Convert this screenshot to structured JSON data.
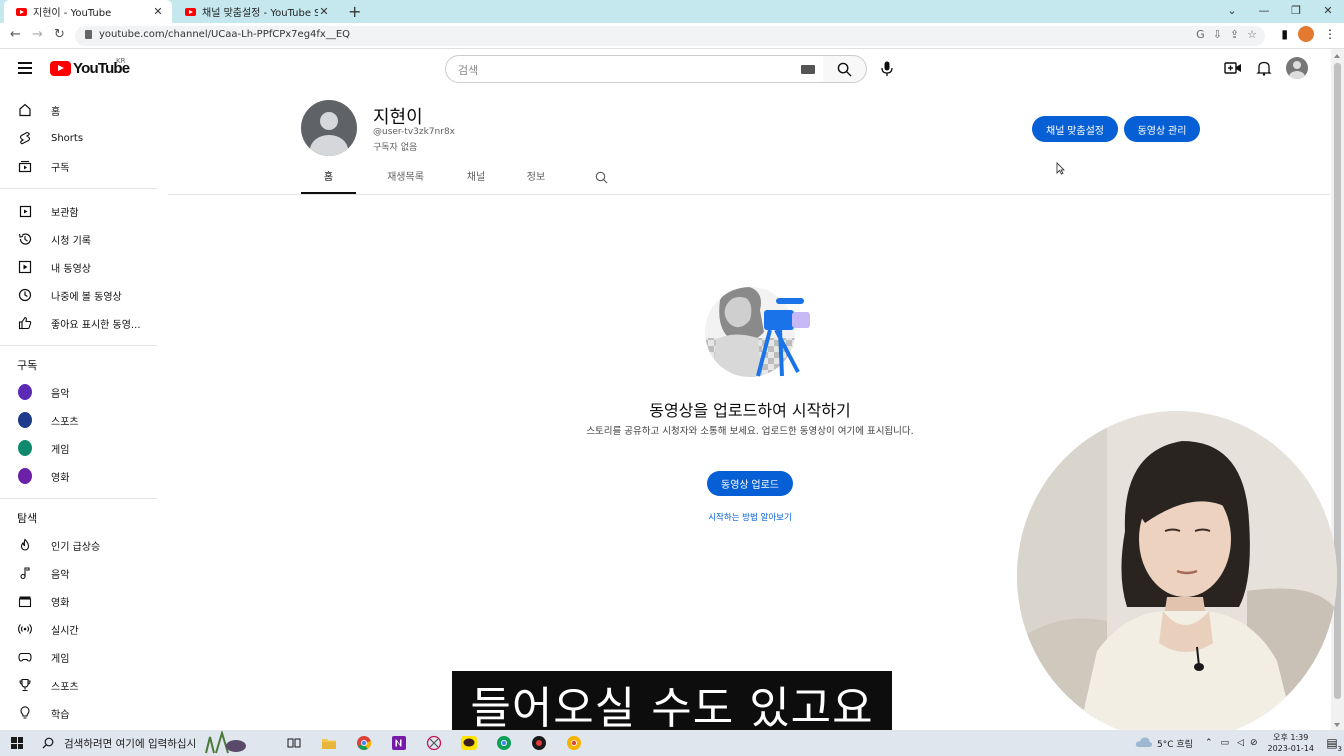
{
  "browser": {
    "tabs": [
      {
        "title": "지현이 - YouTube",
        "active": true
      },
      {
        "title": "채널 맞춤설정 - YouTube Studio",
        "active": false
      }
    ],
    "url": "youtube.com/channel/UCaa-Lh-PPfCPx7eg4fx__EQ"
  },
  "header": {
    "logo_text": "YouTube",
    "logo_region": "KR",
    "search_placeholder": "검색"
  },
  "sidebar": {
    "main": [
      {
        "label": "홈",
        "icon": "home-icon"
      },
      {
        "label": "Shorts",
        "icon": "shorts-icon"
      },
      {
        "label": "구독",
        "icon": "subscriptions-icon"
      }
    ],
    "library": [
      {
        "label": "보관함",
        "icon": "library-icon"
      },
      {
        "label": "시청 기록",
        "icon": "history-icon"
      },
      {
        "label": "내 동영상",
        "icon": "my-videos-icon"
      },
      {
        "label": "나중에 볼 동영상",
        "icon": "watch-later-icon"
      },
      {
        "label": "좋아요 표시한 동영...",
        "icon": "thumbs-up-icon"
      }
    ],
    "subscriptions_title": "구독",
    "subscriptions": [
      {
        "label": "음악",
        "color": "#5b2bb8"
      },
      {
        "label": "스포츠",
        "color": "#1e3a8a"
      },
      {
        "label": "게임",
        "color": "#0f8a6e"
      },
      {
        "label": "영화",
        "color": "#6b21a8"
      }
    ],
    "explore_title": "탐색",
    "explore": [
      {
        "label": "인기 급상승",
        "icon": "trending-icon"
      },
      {
        "label": "음악",
        "icon": "music-note-icon"
      },
      {
        "label": "영화",
        "icon": "clapperboard-icon"
      },
      {
        "label": "실시간",
        "icon": "live-icon"
      },
      {
        "label": "게임",
        "icon": "gamepad-icon"
      },
      {
        "label": "스포츠",
        "icon": "trophy-icon"
      },
      {
        "label": "학습",
        "icon": "lightbulb-icon"
      }
    ]
  },
  "channel": {
    "name": "지현이",
    "handle": "@user-tv3zk7nr8x",
    "subscribers": "구독자 없음",
    "customize_button": "채널 맞춤설정",
    "manage_button": "동영상 관리",
    "tabs": [
      "홈",
      "재생목록",
      "채널",
      "정보"
    ]
  },
  "empty_state": {
    "title": "동영상을 업로드하여 시작하기",
    "description": "스토리를 공유하고 시청자와 소통해 보세요. 업로드한 동영상이 여기에 표시됩니다.",
    "upload_button": "동영상 업로드",
    "learn_link": "시작하는 방법 알아보기"
  },
  "subtitle": "들어오실 수도 있고요",
  "taskbar": {
    "search_placeholder": "검색하려면 여기에 입력하십시",
    "weather": "5°C 흐림",
    "time": "오후 1:39",
    "date": "2023-01-14",
    "notification_count": "3"
  },
  "colors": {
    "accent": "#065fd4",
    "brand": "#ff0000",
    "tabstrip": "#c5e8ee"
  }
}
